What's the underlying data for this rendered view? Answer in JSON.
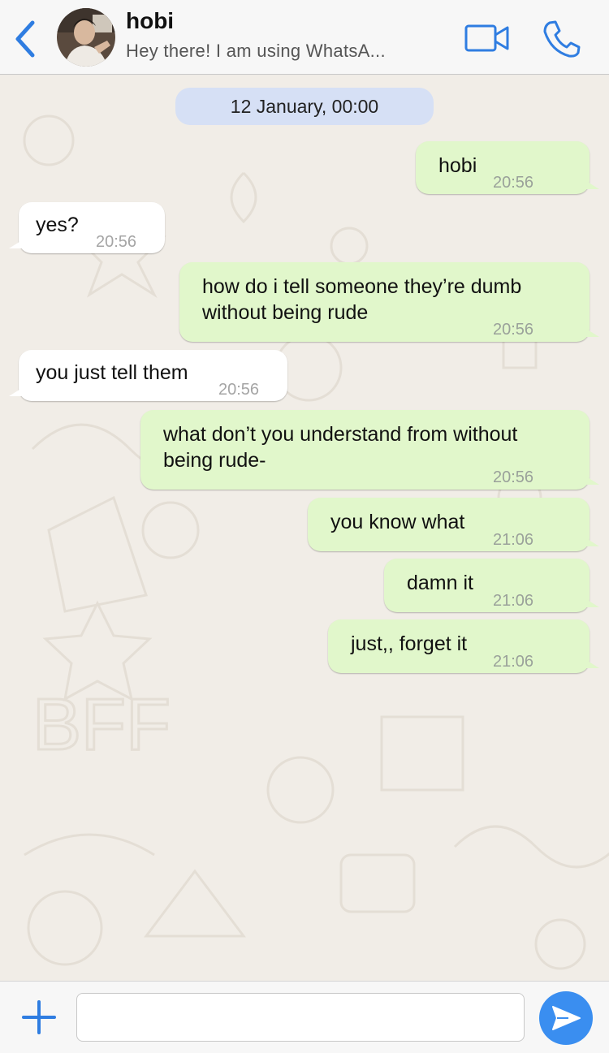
{
  "header": {
    "contact_name": "hobi",
    "status": "Hey there! I am using WhatsA...",
    "accent": "#2f7de1"
  },
  "chat": {
    "date_label": "12 January, 00:00",
    "messages": [
      {
        "direction": "out",
        "lines": [
          "hobi"
        ],
        "time": "20:56"
      },
      {
        "direction": "in",
        "lines": [
          "yes?"
        ],
        "time": "20:56"
      },
      {
        "direction": "out",
        "lines": [
          "how do i tell someone they’re dumb",
          "without being rude"
        ],
        "time": "20:56"
      },
      {
        "direction": "in",
        "lines": [
          "you just tell them"
        ],
        "time": "20:56"
      },
      {
        "direction": "out",
        "lines": [
          "what don’t you understand from without",
          "being rude-"
        ],
        "time": "20:56"
      },
      {
        "direction": "out",
        "lines": [
          "you know what"
        ],
        "time": "21:06"
      },
      {
        "direction": "out",
        "lines": [
          "damn it"
        ],
        "time": "21:06"
      },
      {
        "direction": "out",
        "lines": [
          "just,, forget it"
        ],
        "time": "21:06"
      }
    ],
    "colors": {
      "outgoing": "#e1f7cb",
      "incoming": "#ffffff",
      "date_chip": "#d6e0f5"
    }
  },
  "composer": {
    "value": "",
    "icons": {
      "add": "plus-icon",
      "send": "send-arrow-icon"
    },
    "send_color": "#3a8ef0"
  }
}
